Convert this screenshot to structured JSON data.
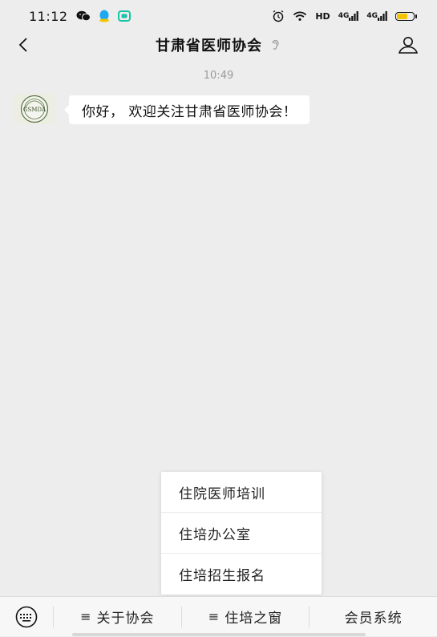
{
  "status_bar": {
    "time": "11:12",
    "network_label": "HD",
    "signal_1": "4G",
    "signal_2": "4G",
    "icons": [
      "wechat-icon",
      "qq-icon",
      "chat-app-icon",
      "alarm-icon",
      "wifi-icon",
      "battery-icon"
    ],
    "battery_color": "#f5c400"
  },
  "header": {
    "title": "甘肃省医师协会",
    "back_icon": "chevron-left-icon",
    "ear_icon": "ear-icon",
    "profile_icon": "person-icon"
  },
  "chat": {
    "timestamp": "10:49",
    "message": "你好， 欢迎关注甘肃省医师协会！",
    "avatar_label": "GSMDA"
  },
  "popup_menu": {
    "items": [
      "住院医师培训",
      "住培办公室",
      "住培招生报名"
    ]
  },
  "bottom_menu": {
    "keyboard_icon": "keyboard-icon",
    "items": [
      {
        "icon": "≡",
        "label": "关于协会"
      },
      {
        "icon": "≡",
        "label": "住培之窗"
      },
      {
        "icon": "",
        "label": "会员系统"
      }
    ]
  },
  "colors": {
    "background": "#ededed",
    "bubble": "#ffffff",
    "timestamp": "#9a9a9a"
  }
}
